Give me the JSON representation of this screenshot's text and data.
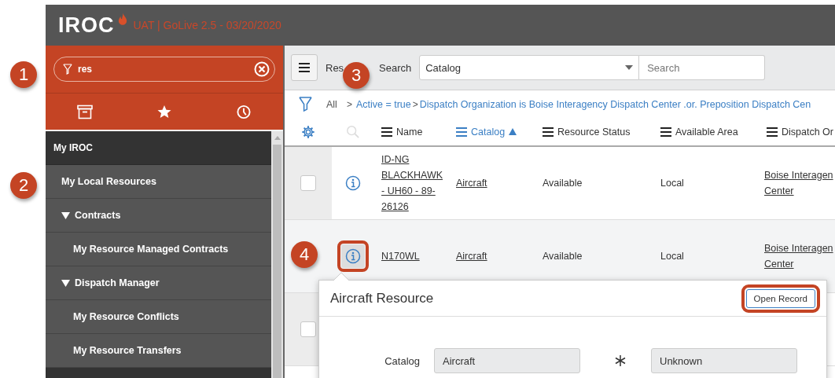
{
  "header": {
    "logo": "IROC",
    "environment": "UAT | GoLive 2.5 - 03/20/2020"
  },
  "sidebar": {
    "filter": {
      "value": "res"
    },
    "items": [
      {
        "kind": "section",
        "label": "My IROC"
      },
      {
        "kind": "link",
        "label": "My Local Resources"
      },
      {
        "kind": "group",
        "label": "Contracts",
        "expanded": true,
        "children": [
          {
            "kind": "link",
            "label": "My Resource Managed Contracts"
          }
        ]
      },
      {
        "kind": "group",
        "label": "Dispatch Manager",
        "expanded": true,
        "children": [
          {
            "kind": "link",
            "label": "My Resource Conflicts"
          },
          {
            "kind": "link",
            "label": "My Resource Transfers"
          }
        ]
      }
    ]
  },
  "toolbar": {
    "title": "Res",
    "search_label": "Search",
    "field_select": "Catalog",
    "search": {
      "placeholder": "Search"
    }
  },
  "breadcrumb": [
    {
      "kind": "root",
      "text": "All"
    },
    {
      "kind": "separator",
      "text": ">"
    },
    {
      "kind": "link",
      "text": "Active = true"
    },
    {
      "kind": "separator",
      "text": ">"
    },
    {
      "kind": "link",
      "text": "Dispatch Organization is Boise Interagency Dispatch Center .or. Preposition Dispatch Cen"
    }
  ],
  "columns": [
    {
      "label": "Name",
      "sorted": false
    },
    {
      "label": "Catalog",
      "sorted": true
    },
    {
      "label": "Resource Status",
      "sorted": false
    },
    {
      "label": "Available Area",
      "sorted": false
    },
    {
      "label": "Dispatch Or",
      "sorted": false
    }
  ],
  "rows": [
    {
      "checked": false,
      "highlighted": false,
      "name": "ID-NG BLACKHAWK - UH60 - 89-26126",
      "catalog": "Aircraft",
      "status": "Available",
      "area": "Local",
      "org": [
        "Boise Interagen",
        "Center"
      ]
    },
    {
      "highlighted": true,
      "info_callout": true,
      "name": "N170WL",
      "catalog": "Aircraft",
      "status": "Available",
      "area": "Local",
      "org": [
        "Boise Interagen",
        "Center"
      ]
    },
    {
      "checked": false,
      "highlighted": false
    }
  ],
  "popup": {
    "title": "Aircraft Resource",
    "button": {
      "label": "Open Record",
      "callout": true
    },
    "fields": [
      {
        "label": "Catalog",
        "value": "Aircraft"
      },
      {
        "required": true,
        "value": "Unknown"
      }
    ]
  },
  "callouts": [
    "1",
    "2",
    "3",
    "4"
  ]
}
